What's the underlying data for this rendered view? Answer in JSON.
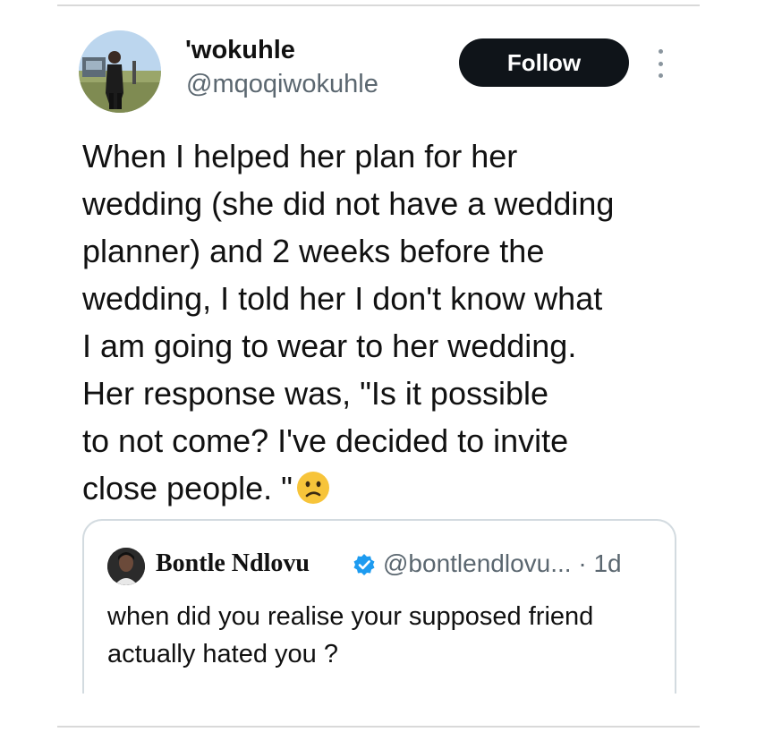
{
  "tweet": {
    "author": {
      "display_name": "'wokuhle",
      "handle": "@mqoqiwokuhle",
      "avatar_icon": "profile-photo"
    },
    "follow_label": "Follow",
    "more_icon": "more-options-icon",
    "text_lines": [
      "When I helped her plan for her",
      "wedding (she did not have a wedding",
      "planner) and 2 weeks before the",
      "wedding, I told her I don't know what",
      "I am going to wear to her wedding.",
      "Her response was, \"Is it possible",
      "to not come? I've decided to invite",
      "close people. \""
    ],
    "emoji": "confused-face-emoji"
  },
  "quoted_tweet": {
    "display_name": "Bontle Ndlovu",
    "verified": true,
    "handle_and_time": "@bontlendlovu... · 1d",
    "text_lines": [
      "when did you realise your supposed friend",
      "actually hated you ?"
    ]
  },
  "colors": {
    "follow_bg": "#0f1419",
    "verified_blue": "#1d9bf0",
    "secondary_text": "#5b6770",
    "emoji_yellow": "#f7c43a"
  }
}
